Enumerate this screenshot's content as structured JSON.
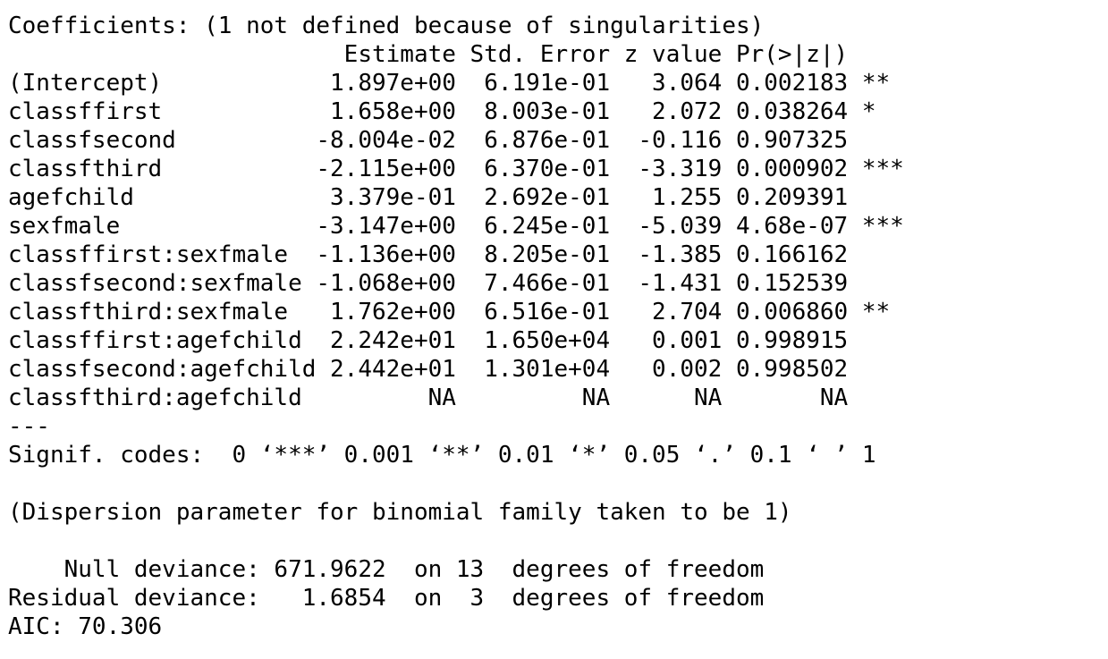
{
  "console": {
    "lines": [
      "Coefficients: (1 not defined because of singularities)",
      "                        Estimate Std. Error z value Pr(>|z|)    ",
      "(Intercept)            1.897e+00  6.191e-01   3.064 0.002183 ** ",
      "classffirst            1.658e+00  8.003e-01   2.072 0.038264 *  ",
      "classfsecond          -8.004e-02  6.876e-01  -0.116 0.907325    ",
      "classfthird           -2.115e+00  6.370e-01  -3.319 0.000902 ***",
      "agefchild              3.379e-01  2.692e-01   1.255 0.209391    ",
      "sexfmale              -3.147e+00  6.245e-01  -5.039 4.68e-07 ***",
      "classffirst:sexfmale  -1.136e+00  8.205e-01  -1.385 0.166162    ",
      "classfsecond:sexfmale -1.068e+00  7.466e-01  -1.431 0.152539    ",
      "classfthird:sexfmale   1.762e+00  6.516e-01   2.704 0.006860 ** ",
      "classffirst:agefchild  2.242e+01  1.650e+04   0.001 0.998915    ",
      "classfsecond:agefchild 2.442e+01  1.301e+04   0.002 0.998502    ",
      "classfthird:agefchild         NA         NA      NA       NA    ",
      "---",
      "Signif. codes:  0 ‘***’ 0.001 ‘**’ 0.01 ‘*’ 0.05 ‘.’ 0.1 ‘ ’ 1",
      "",
      "(Dispersion parameter for binomial family taken to be 1)",
      "",
      "    Null deviance: 671.9622  on 13  degrees of freedom",
      "Residual deviance:   1.6854  on  3  degrees of freedom",
      "AIC: 70.306"
    ]
  }
}
